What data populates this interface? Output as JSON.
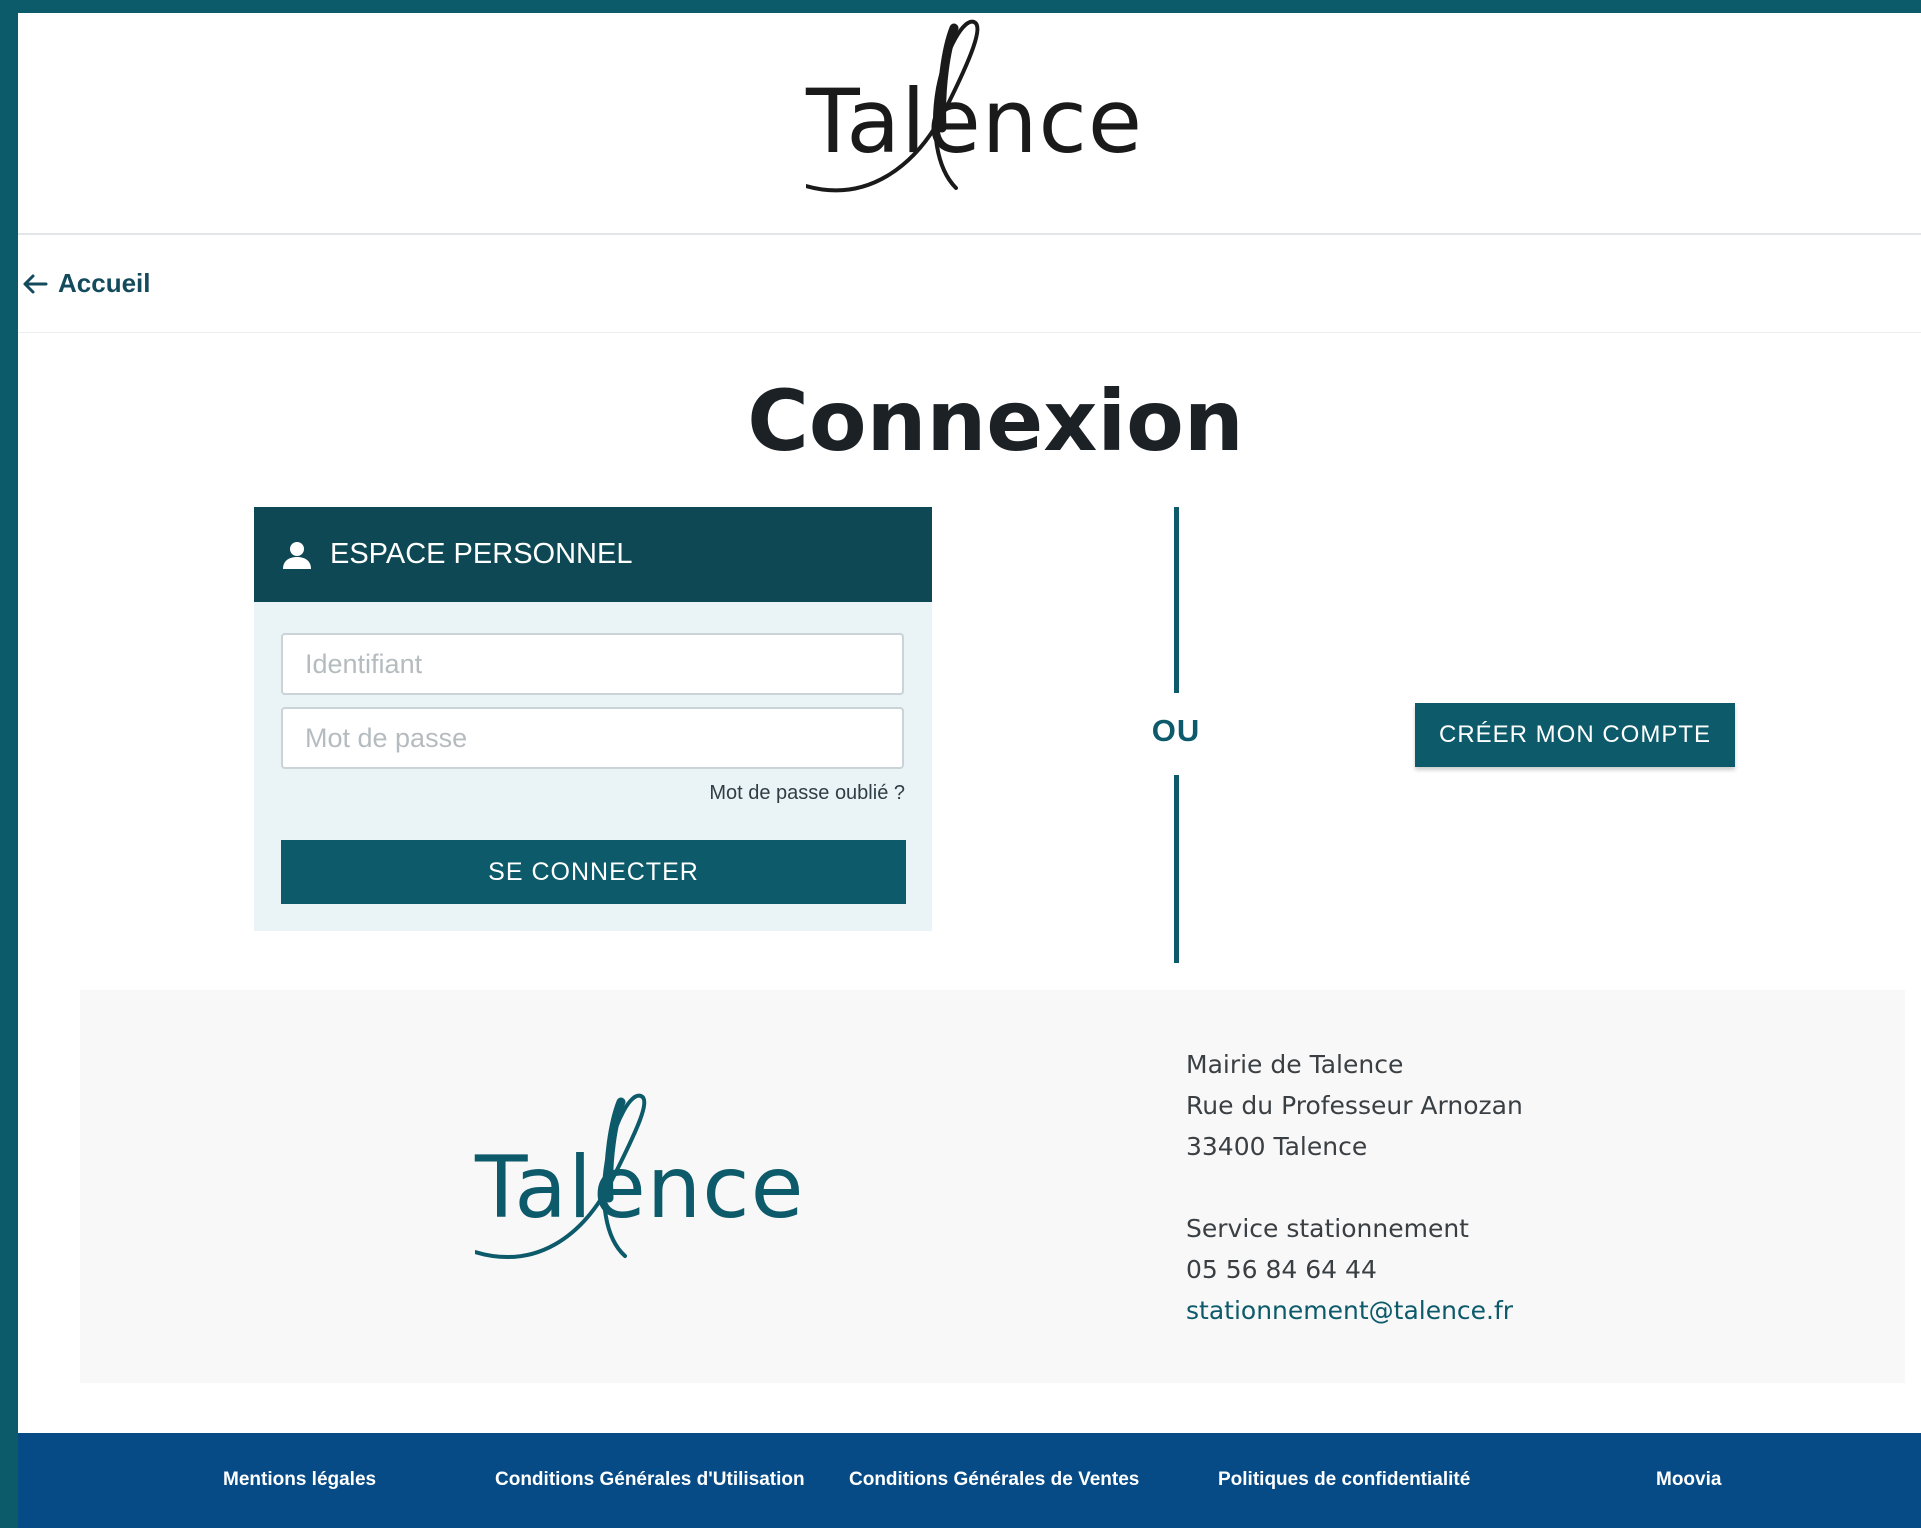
{
  "brand": {
    "logo_text": "Talence",
    "primary_color": "#0c5a6a",
    "header_color": "#0d4854",
    "footer_bar_color": "#064b86"
  },
  "nav": {
    "back_label": "Accueil"
  },
  "page": {
    "title": "Connexion"
  },
  "login": {
    "header": "ESPACE PERSONNEL",
    "username_placeholder": "Identifiant",
    "password_placeholder": "Mot de passe",
    "forgot_label": "Mot de passe oublié ?",
    "submit_label": "SE CONNECTER"
  },
  "separator": "OU",
  "register": {
    "label": "CRÉER MON COMPTE"
  },
  "contact": {
    "name": "Mairie de Talence",
    "street": "Rue du Professeur Arnozan",
    "city": "33400 Talence",
    "service": "Service stationnement",
    "phone": "05 56 84 64 44",
    "email": "stationnement@talence.fr"
  },
  "footer_links": [
    "Mentions légales",
    "Conditions Générales d'Utilisation",
    "Conditions Générales de Ventes",
    "Politiques de confidentialité",
    "Moovia"
  ]
}
